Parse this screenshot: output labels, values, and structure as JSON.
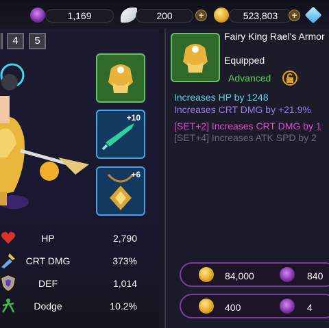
{
  "currencies": {
    "souls": "1,169",
    "feathers": "200",
    "gold": "523,803"
  },
  "tabs": [
    "4",
    "5"
  ],
  "slots": [
    {
      "name": "armor",
      "level": ""
    },
    {
      "name": "weapon",
      "level": "+10"
    },
    {
      "name": "necklace",
      "level": "+6"
    }
  ],
  "stats": [
    {
      "name": "HP",
      "value": "2,790"
    },
    {
      "name": "CRT DMG",
      "value": "373%"
    },
    {
      "name": "DEF",
      "value": "1,014"
    },
    {
      "name": "Dodge",
      "value": "10.2%"
    }
  ],
  "item": {
    "name": "Fairy King Rael's Armor",
    "status": "Equipped",
    "grade": "Advanced",
    "lines": [
      {
        "text": "Increases HP by 1248",
        "color": "#5fd3e8"
      },
      {
        "text": "Increases CRT DMG by +21.9%",
        "color": "#9a7cf0"
      },
      {
        "text": "[SET+2] Increases CRT DMG by 1",
        "color": "#e64ad2"
      },
      {
        "text": "[SET+4] Increases ATK SPD by 2",
        "color": "#6a6a78"
      }
    ]
  },
  "prices": [
    {
      "gold": "84,000",
      "souls": "840"
    },
    {
      "gold": "400",
      "souls": "4"
    }
  ]
}
